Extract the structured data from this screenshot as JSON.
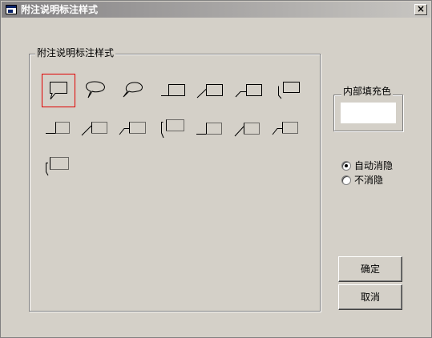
{
  "window": {
    "title": "附注说明标注样式",
    "close_glyph": "×",
    "icon": "app-window-icon"
  },
  "styles_group": {
    "label": "附注说明标注样式",
    "selected": "callout-rect-bubble",
    "items": [
      "callout-rect-bubble",
      "callout-ellipse-bubble",
      "callout-oval-bubble",
      "callout-box-underline",
      "callout-box-diagonal",
      "callout-box-bent",
      "callout-box-corner",
      "callout-dotted-underline",
      "callout-dotted-diagonal",
      "callout-dotted-bent",
      "callout-dotted-corner-bracket",
      "callout-dotted-underline-2",
      "callout-dotted-diagonal-2",
      "callout-dotted-bent-2",
      "callout-dotted-corner-bracket-2"
    ]
  },
  "fill_group": {
    "label": "内部填充色",
    "fill_color": "#ffffff"
  },
  "options": {
    "auto_hide_label": "自动消隐",
    "auto_hide_checked": true,
    "no_hide_label": "不消隐",
    "no_hide_checked": false
  },
  "buttons": {
    "ok": "确定",
    "cancel": "取消"
  },
  "colors": {
    "face": "#d4d0c8",
    "selection_border": "#e00000",
    "title_gradient_start": "#848284"
  }
}
